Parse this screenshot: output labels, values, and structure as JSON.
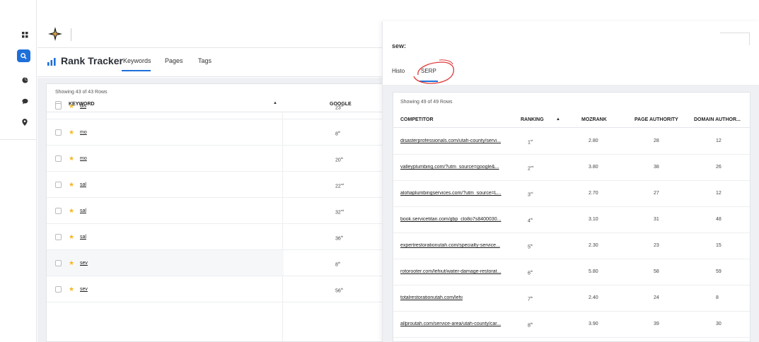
{
  "rail": {
    "icons": [
      "apps-grid-icon",
      "search-icon",
      "pie-chart-icon",
      "chat-icon",
      "location-pin-icon"
    ],
    "accent": "#1e6fd9"
  },
  "header": {
    "title": "Rank Tracker",
    "tabs": [
      {
        "label": "Keywords",
        "active": true
      },
      {
        "label": "Pages",
        "active": false
      },
      {
        "label": "Tags",
        "active": false
      }
    ]
  },
  "keywords": {
    "showing": "Showing 43 of 43 Rows",
    "col_keyword": "KEYWORD",
    "col_google": "GOOGLE",
    "sort_indicator": "▲",
    "rows": [
      {
        "keyword": "dis",
        "rank": "23",
        "suffix": "rd",
        "highlighted": false
      },
      {
        "keyword": "mo",
        "rank": "8",
        "suffix": "th",
        "highlighted": false
      },
      {
        "keyword": "mo",
        "rank": "20",
        "suffix": "th",
        "highlighted": false
      },
      {
        "keyword": "sal",
        "rank": "22",
        "suffix": "nd",
        "highlighted": false
      },
      {
        "keyword": "sal",
        "rank": "32",
        "suffix": "nd",
        "highlighted": false
      },
      {
        "keyword": "sal",
        "rank": "36",
        "suffix": "th",
        "highlighted": false
      },
      {
        "keyword": "sev",
        "rank": "8",
        "suffix": "th",
        "highlighted": true
      },
      {
        "keyword": "sev",
        "rank": "56",
        "suffix": "th",
        "highlighted": false
      }
    ]
  },
  "panel": {
    "title": "sew:",
    "tabs": [
      {
        "label": "Histo",
        "active": false
      },
      {
        "label": "SERP",
        "active": true
      }
    ],
    "showing": "Showing 49 of 49 Rows",
    "columns": {
      "competitor": "COMPETITOR",
      "ranking": "RANKING",
      "sort": "▲",
      "mozrank": "MOZRANK",
      "page_authority": "PAGE AUTHORITY",
      "domain_authority": "DOMAIN AUTHOR..."
    },
    "rows": [
      {
        "competitor": "disasterprofessionals.com/utah-county/servi...",
        "rank": "1",
        "suffix": "st",
        "mozrank": "2.80",
        "pa": "28",
        "da": "12"
      },
      {
        "competitor": "valleyplumbing.com/?utm_source=google&...",
        "rank": "2",
        "suffix": "nd",
        "mozrank": "3.80",
        "pa": "38",
        "da": "26"
      },
      {
        "competitor": "alohaplumbingservices.com/?utm_source=L...",
        "rank": "3",
        "suffix": "rd",
        "mozrank": "2.70",
        "pa": "27",
        "da": "12"
      },
      {
        "competitor": "book.servicetitan.com/gbp_clo8o7s8400030...",
        "rank": "4",
        "suffix": "th",
        "mozrank": "3.10",
        "pa": "31",
        "da": "48"
      },
      {
        "competitor": "expertrestorationutah.com/specialty-service...",
        "rank": "5",
        "suffix": "th",
        "mozrank": "2.30",
        "pa": "23",
        "da": "15"
      },
      {
        "competitor": "rotorooter.com/lehiut/water-damage-restorat...",
        "rank": "6",
        "suffix": "th",
        "mozrank": "5.80",
        "pa": "58",
        "da": "59"
      },
      {
        "competitor": "totalrestorationutah.com/lehi",
        "rank": "7",
        "suffix": "th",
        "mozrank": "2.40",
        "pa": "24",
        "da": "8"
      },
      {
        "competitor": "allproutah.com/service-area/utah-county/car...",
        "rank": "8",
        "suffix": "th",
        "mozrank": "3.90",
        "pa": "39",
        "da": "30"
      }
    ]
  }
}
